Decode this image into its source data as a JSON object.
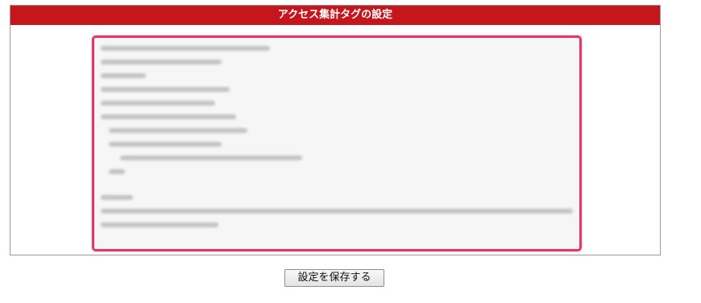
{
  "panel": {
    "title": "アクセス集計タグの設定",
    "header_color": "#c4161c",
    "highlight_color": "#e8336b"
  },
  "code_area": {
    "content": ""
  },
  "actions": {
    "save_label": "設定を保存する"
  }
}
